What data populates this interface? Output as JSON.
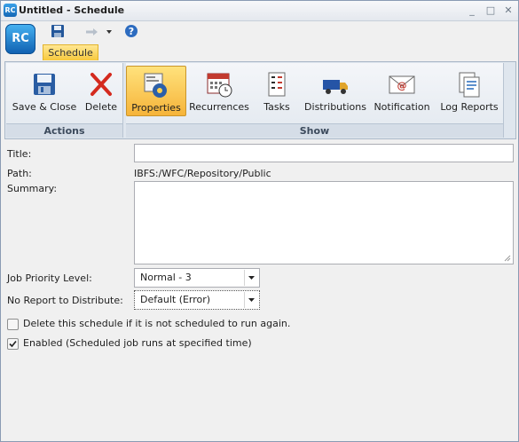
{
  "window": {
    "title": "Untitled - Schedule",
    "app_icon_text": "RC",
    "minimize_label": "_",
    "maximize_label": "□",
    "close_label": "✕"
  },
  "qat": {
    "logo_text": "RC",
    "icons": [
      "save-icon",
      "redo-icon",
      "dropdown-icon",
      "help-icon"
    ]
  },
  "tab": {
    "label": "Schedule"
  },
  "ribbon": {
    "groups": [
      {
        "label": "Actions",
        "buttons": [
          "Save & Close",
          "Delete"
        ]
      },
      {
        "label": "Show",
        "buttons": [
          "Properties",
          "Recurrences",
          "Tasks",
          "Distributions",
          "Notification",
          "Log Reports"
        ]
      }
    ],
    "active_button": "Properties"
  },
  "form": {
    "title_label": "Title:",
    "title_value": "",
    "path_label": "Path:",
    "path_value": "IBFS:/WFC/Repository/Public",
    "summary_label": "Summary:",
    "summary_value": "",
    "priority_label": "Job Priority Level:",
    "priority_value": "Normal - 3",
    "noreport_label": "No Report to Distribute:",
    "noreport_value": "Default (Error)",
    "delete_check_label": "Delete this schedule if it is not scheduled to run again.",
    "delete_checked": false,
    "enabled_check_label": "Enabled (Scheduled job runs at specified time)",
    "enabled_checked": true
  },
  "colors": {
    "accent_tab": "#f7c93e",
    "active_button": "#f6b43a",
    "logo_blue": "#1467b5"
  }
}
